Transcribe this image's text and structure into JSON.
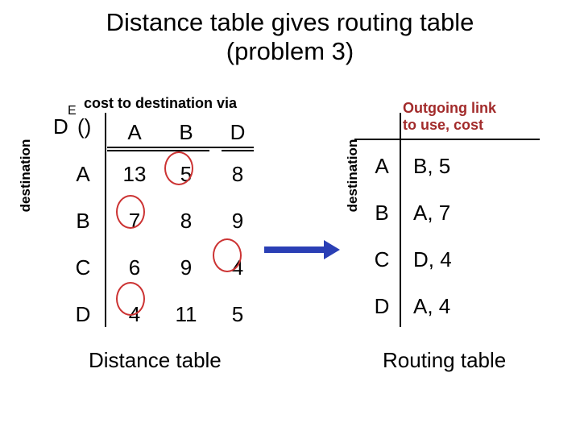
{
  "title": "Distance table gives routing table\n(problem 3)",
  "cost_guide": "cost to destination via",
  "outgoing_guide": "Outgoing link\nto use, cost",
  "dist": {
    "label_D": "D",
    "label_E": "E",
    "label_paren": "()",
    "col_A": "A",
    "col_B": "B",
    "col_D": "D",
    "rows": [
      {
        "dest": "A",
        "A": "13",
        "B": "5",
        "D": "8"
      },
      {
        "dest": "B",
        "A": "7",
        "B": "8",
        "D": "9"
      },
      {
        "dest": "C",
        "A": "6",
        "B": "9",
        "D": "4"
      },
      {
        "dest": "D",
        "A": "4",
        "B": "11",
        "D": "5"
      }
    ]
  },
  "vlabel": "destination",
  "routing": {
    "rows": [
      {
        "dest": "A",
        "link": "B, 5"
      },
      {
        "dest": "B",
        "link": "A, 7"
      },
      {
        "dest": "C",
        "link": "D, 4"
      },
      {
        "dest": "D",
        "link": "A, 4"
      }
    ]
  },
  "caption_left": "Distance table",
  "caption_right": "Routing table"
}
